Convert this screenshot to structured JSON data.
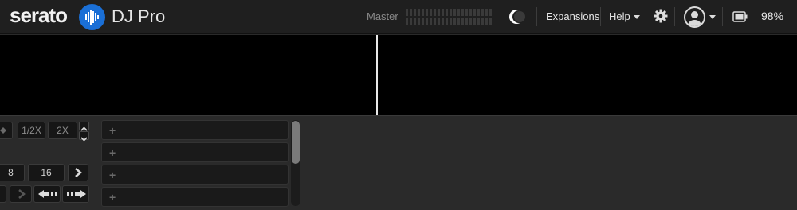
{
  "app": {
    "logo_text": "serato",
    "product": "DJ Pro",
    "brand_color": "#1a6fd6"
  },
  "header": {
    "master_label": "Master",
    "expansions_label": "Expansions",
    "help_label": "Help",
    "battery_percent": "98%"
  },
  "loop_controls": {
    "half_label": "1/2X",
    "double_label": "2X",
    "beat_8": "8",
    "beat_16": "16"
  },
  "cue_slots": [
    {
      "label": "+"
    },
    {
      "label": "+"
    },
    {
      "label": "+"
    },
    {
      "label": "+"
    }
  ],
  "annotation": {
    "arrow_color": "#e8141c"
  }
}
